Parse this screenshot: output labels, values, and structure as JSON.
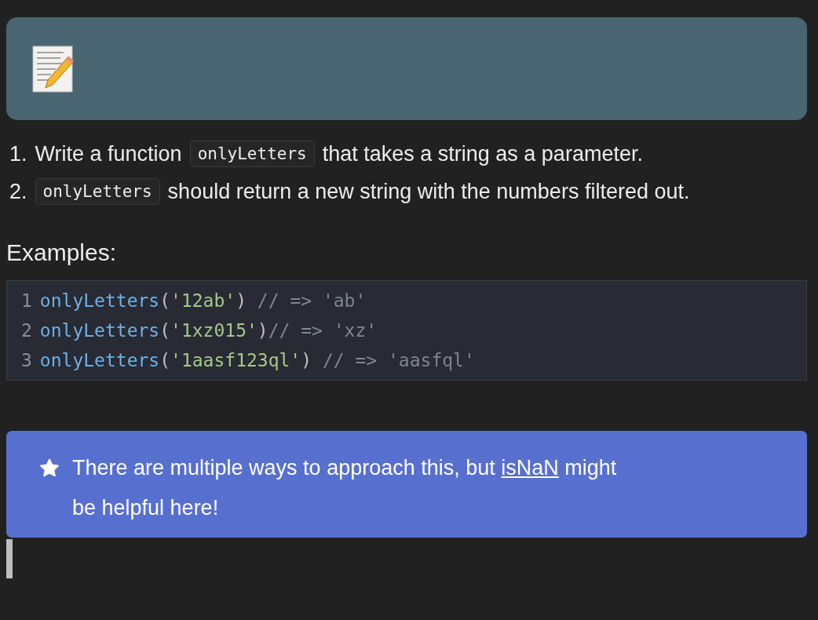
{
  "steps": [
    {
      "number": "1.",
      "parts": [
        {
          "kind": "text",
          "text": "Write a function"
        },
        {
          "kind": "code",
          "text": "onlyLetters"
        },
        {
          "kind": "text",
          "text": "that takes a string as a parameter."
        }
      ]
    },
    {
      "number": "2.",
      "parts": [
        {
          "kind": "code",
          "text": "onlyLetters"
        },
        {
          "kind": "text",
          "text": "should return a new string with the numbers filtered out."
        }
      ]
    }
  ],
  "examples_heading": "Examples:",
  "code_block": {
    "lines": [
      {
        "number": "1",
        "tokens": [
          {
            "kind": "function",
            "text": "onlyLetters"
          },
          {
            "kind": "punct",
            "text": "("
          },
          {
            "kind": "string",
            "text": "'12ab'"
          },
          {
            "kind": "punct",
            "text": ")"
          },
          {
            "kind": "comment",
            "text": " // => 'ab'"
          }
        ]
      },
      {
        "number": "2",
        "tokens": [
          {
            "kind": "function",
            "text": "onlyLetters"
          },
          {
            "kind": "punct",
            "text": "("
          },
          {
            "kind": "string",
            "text": "'1xz015'"
          },
          {
            "kind": "punct",
            "text": ")"
          },
          {
            "kind": "comment",
            "text": "// => 'xz'"
          }
        ]
      },
      {
        "number": "3",
        "tokens": [
          {
            "kind": "function",
            "text": "onlyLetters"
          },
          {
            "kind": "punct",
            "text": "("
          },
          {
            "kind": "string",
            "text": "'1aasf123ql'"
          },
          {
            "kind": "punct",
            "text": ")"
          },
          {
            "kind": "comment",
            "text": " // => 'aasfql'"
          }
        ]
      }
    ]
  },
  "hint": {
    "before": "There are multiple ways to approach this, but ",
    "link": "isNaN",
    "after": " might be helpful here!"
  }
}
